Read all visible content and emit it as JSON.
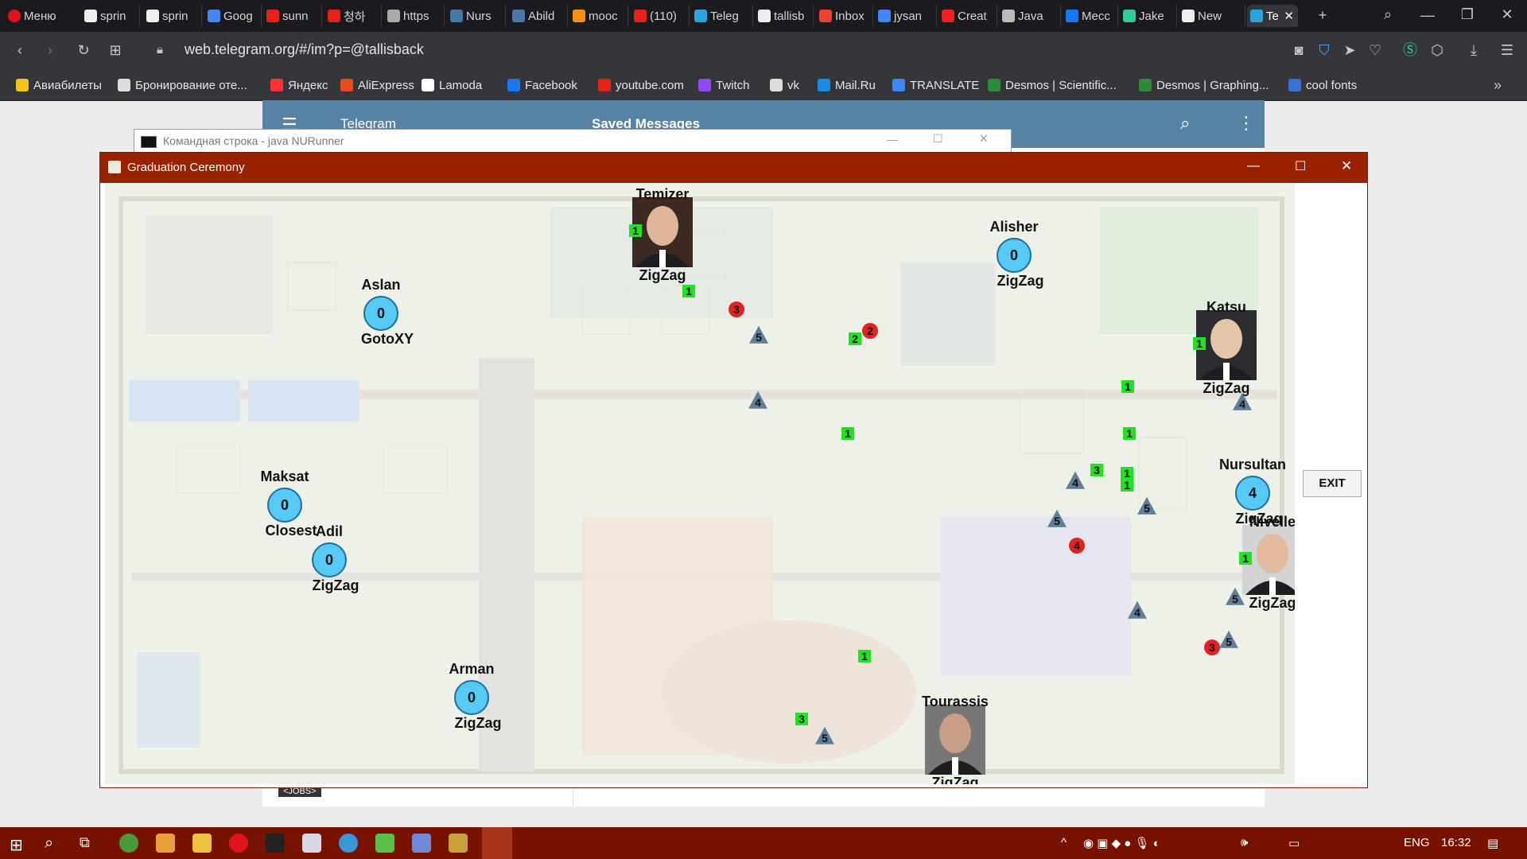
{
  "browser": {
    "menu_label": "Меню",
    "tabs": [
      {
        "label": "sprin",
        "icon": "github-icon"
      },
      {
        "label": "sprin",
        "icon": "github-icon"
      },
      {
        "label": "Goog",
        "icon": "google-icon"
      },
      {
        "label": "sunn",
        "icon": "youtube-icon"
      },
      {
        "label": "청하",
        "icon": "youtube-icon"
      },
      {
        "label": "https",
        "icon": "link-icon"
      },
      {
        "label": "Nurs",
        "icon": "vk-icon"
      },
      {
        "label": "Abild",
        "icon": "vk-icon"
      },
      {
        "label": "mooc",
        "icon": "mooc-icon"
      },
      {
        "label": "(110)",
        "icon": "youtube-icon"
      },
      {
        "label": "Teleg",
        "icon": "telegram-icon"
      },
      {
        "label": "tallisb",
        "icon": "github-icon"
      },
      {
        "label": "Inbox",
        "icon": "gmail-icon"
      },
      {
        "label": "jysan",
        "icon": "google-icon"
      },
      {
        "label": "Creat",
        "icon": "creator-icon"
      },
      {
        "label": "Java",
        "icon": "bolt-icon"
      },
      {
        "label": "Mecc",
        "icon": "messenger-icon"
      },
      {
        "label": "Jake",
        "icon": "leaf-icon"
      },
      {
        "label": "New",
        "icon": "github-icon"
      },
      {
        "label": "Te",
        "icon": "telegram-icon"
      }
    ],
    "url": "web.telegram.org/#/im?p=@tallisback",
    "bookmarks": [
      {
        "label": "Авиабилеты",
        "icon": "plane-icon"
      },
      {
        "label": "Бронирование оте...",
        "icon": "page-icon"
      },
      {
        "label": "Яндекс",
        "icon": "yandex-icon"
      },
      {
        "label": "AliExpress",
        "icon": "aliexpress-icon"
      },
      {
        "label": "Lamoda",
        "icon": "lamoda-icon"
      },
      {
        "label": "Facebook",
        "icon": "facebook-icon"
      },
      {
        "label": "youtube.com",
        "icon": "youtube-icon"
      },
      {
        "label": "Twitch",
        "icon": "twitch-icon"
      },
      {
        "label": "vk",
        "icon": "page-icon"
      },
      {
        "label": "Mail.Ru",
        "icon": "mailru-icon"
      },
      {
        "label": "TRANSLATE",
        "icon": "translate-icon"
      },
      {
        "label": "Desmos | Scientific...",
        "icon": "desmos-icon"
      },
      {
        "label": "Desmos | Graphing...",
        "icon": "desmos-icon"
      },
      {
        "label": "cool fonts",
        "icon": "c-icon"
      }
    ]
  },
  "telegram": {
    "app_name": "Telegram",
    "chat_title": "Saved Messages",
    "footer_tag": "<JOBS>"
  },
  "cmd_window": {
    "title": "Командная строка - java  NURunner"
  },
  "app": {
    "title": "Graduation Ceremony",
    "exit_label": "EXIT",
    "agents": [
      {
        "name": "Temizer",
        "mode": "ZigZag",
        "value": null,
        "photo": true,
        "badge": "1"
      },
      {
        "name": "Alisher",
        "mode": "ZigZag",
        "value": "0",
        "photo": false
      },
      {
        "name": "Aslan",
        "mode": "GotoXY",
        "value": "0",
        "photo": false
      },
      {
        "name": "Katsu",
        "mode": "ZigZag",
        "value": null,
        "photo": true,
        "badge": "1"
      },
      {
        "name": "Nursultan",
        "mode": "ZigZag",
        "value": "4",
        "photo": false
      },
      {
        "name": "Nivelle",
        "mode": "ZigZag",
        "value": null,
        "photo": true,
        "badge": "1"
      },
      {
        "name": "Maksat",
        "mode": "Closest",
        "value": "0",
        "photo": false
      },
      {
        "name": "Adil",
        "mode": "ZigZag",
        "value": "0",
        "photo": false
      },
      {
        "name": "Arman",
        "mode": "ZigZag",
        "value": "0",
        "photo": false
      },
      {
        "name": "Tourassis",
        "mode": "ZigZag",
        "value": null,
        "photo": true
      }
    ],
    "items": [
      {
        "shape": "square",
        "label": "1"
      },
      {
        "shape": "circle",
        "label": "3"
      },
      {
        "shape": "triangle",
        "label": "5"
      },
      {
        "shape": "square",
        "label": "2"
      },
      {
        "shape": "circle",
        "label": "2"
      },
      {
        "shape": "triangle",
        "label": "4"
      },
      {
        "shape": "square",
        "label": "1"
      },
      {
        "shape": "square",
        "label": "1"
      },
      {
        "shape": "square",
        "label": "1"
      },
      {
        "shape": "square",
        "label": "3"
      },
      {
        "shape": "triangle",
        "label": "4"
      },
      {
        "shape": "square",
        "label": "1"
      },
      {
        "shape": "square",
        "label": "1"
      },
      {
        "shape": "triangle",
        "label": "5"
      },
      {
        "shape": "triangle",
        "label": "5"
      },
      {
        "shape": "circle",
        "label": "4"
      },
      {
        "shape": "triangle",
        "label": "4"
      },
      {
        "shape": "triangle",
        "label": "5"
      },
      {
        "shape": "triangle",
        "label": "5"
      },
      {
        "shape": "circle",
        "label": "3"
      },
      {
        "shape": "square",
        "label": "1"
      },
      {
        "shape": "square",
        "label": "3"
      },
      {
        "shape": "triangle",
        "label": "5"
      },
      {
        "shape": "triangle",
        "label": "4"
      }
    ]
  },
  "taskbar": {
    "lang": "ENG",
    "time": "16:32"
  }
}
